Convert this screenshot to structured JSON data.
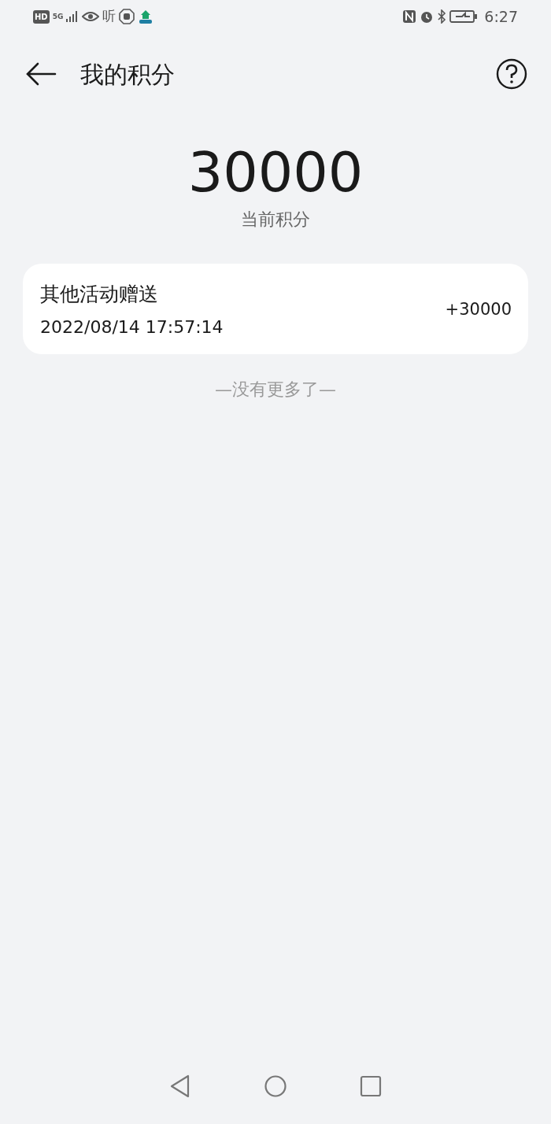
{
  "status_bar": {
    "left_texts": [
      "HD",
      "5G",
      "听"
    ],
    "time": "6:27"
  },
  "header": {
    "title": "我的积分"
  },
  "balance": {
    "value": "30000",
    "label": "当前积分"
  },
  "records": [
    {
      "title": "其他活动赠送",
      "time": "2022/08/14 17:57:14",
      "amount": "+30000"
    }
  ],
  "end_note": "—没有更多了—"
}
